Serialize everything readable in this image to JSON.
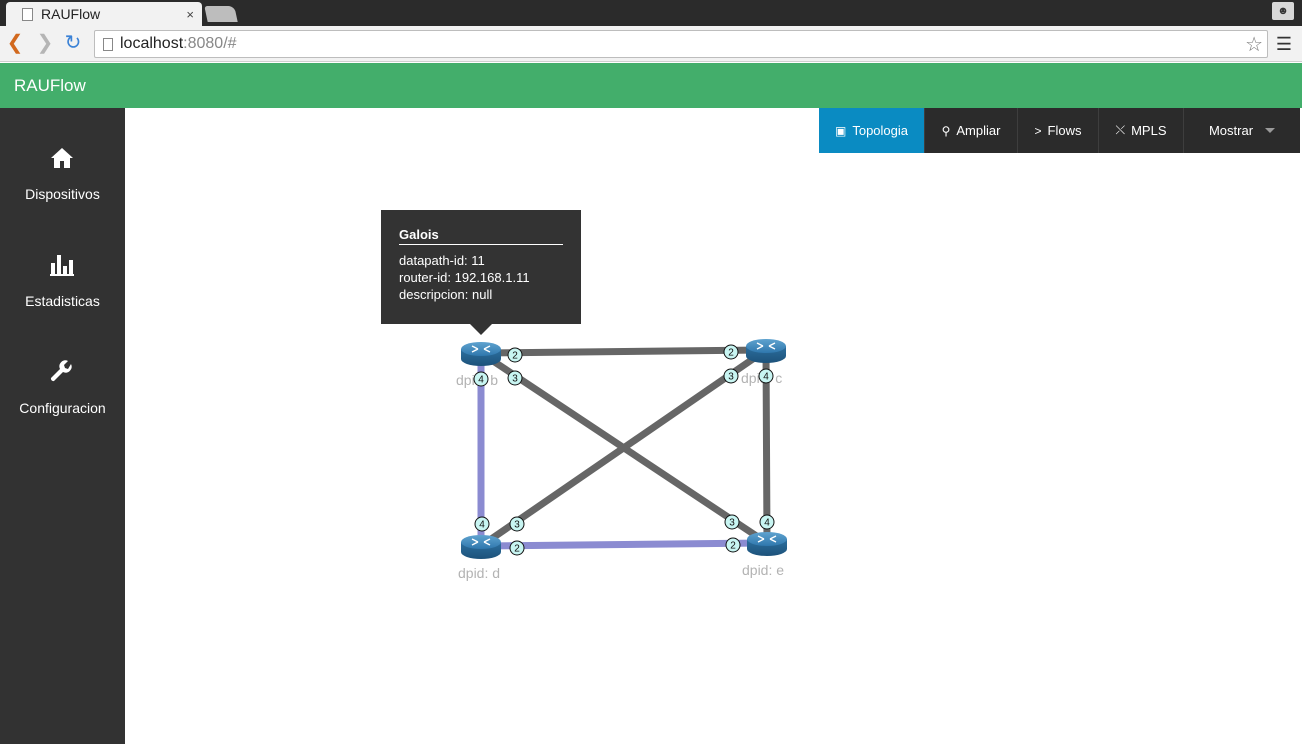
{
  "browser": {
    "tab_title": "RAUFlow",
    "tab_close": "×",
    "url_host": "localhost",
    "url_rest": ":8080/#"
  },
  "app": {
    "brand": "RAUFlow"
  },
  "sidebar": {
    "items": [
      {
        "label": "Dispositivos",
        "icon": "home-icon"
      },
      {
        "label": "Estadisticas",
        "icon": "bar-chart-icon"
      },
      {
        "label": "Configuracion",
        "icon": "wrench-icon"
      }
    ]
  },
  "tabs": [
    {
      "label": "Topologia",
      "icon": "image-icon",
      "active": true
    },
    {
      "label": "Ampliar",
      "icon": "search-icon",
      "active": false
    },
    {
      "label": "Flows",
      "icon": "chevron-right-icon",
      "active": false
    },
    {
      "label": "MPLS",
      "icon": "shuffle-icon",
      "active": false
    },
    {
      "label": "Mostrar",
      "icon": "caret-down-icon",
      "active": false
    }
  ],
  "tooltip": {
    "title": "Galois",
    "datapath_id": "datapath-id: 11",
    "router_id": "router-id: 192.168.1.11",
    "descripcion": "descripcion: null"
  },
  "topology": {
    "nodes": [
      {
        "id": "b",
        "label": "dpid: b"
      },
      {
        "id": "c",
        "label": "dpid: c"
      },
      {
        "id": "d",
        "label": "dpid: d"
      },
      {
        "id": "e",
        "label": "dpid: e"
      }
    ],
    "colors": {
      "link_default": "#666666",
      "link_highlight": "#8b8bd1",
      "port_fill": "#c8f5f2"
    },
    "links": [
      {
        "from": "b",
        "from_port": "2",
        "to": "c",
        "to_port": "2",
        "highlight": false
      },
      {
        "from": "b",
        "from_port": "3",
        "to": "e",
        "to_port": "3",
        "highlight": false
      },
      {
        "from": "c",
        "from_port": "3",
        "to": "d",
        "to_port": "3",
        "highlight": false
      },
      {
        "from": "c",
        "from_port": "4",
        "to": "e",
        "to_port": "4",
        "highlight": false
      },
      {
        "from": "b",
        "from_port": "4",
        "to": "d",
        "to_port": "4",
        "highlight": true
      },
      {
        "from": "d",
        "from_port": "2",
        "to": "e",
        "to_port": "2",
        "highlight": true
      }
    ]
  }
}
